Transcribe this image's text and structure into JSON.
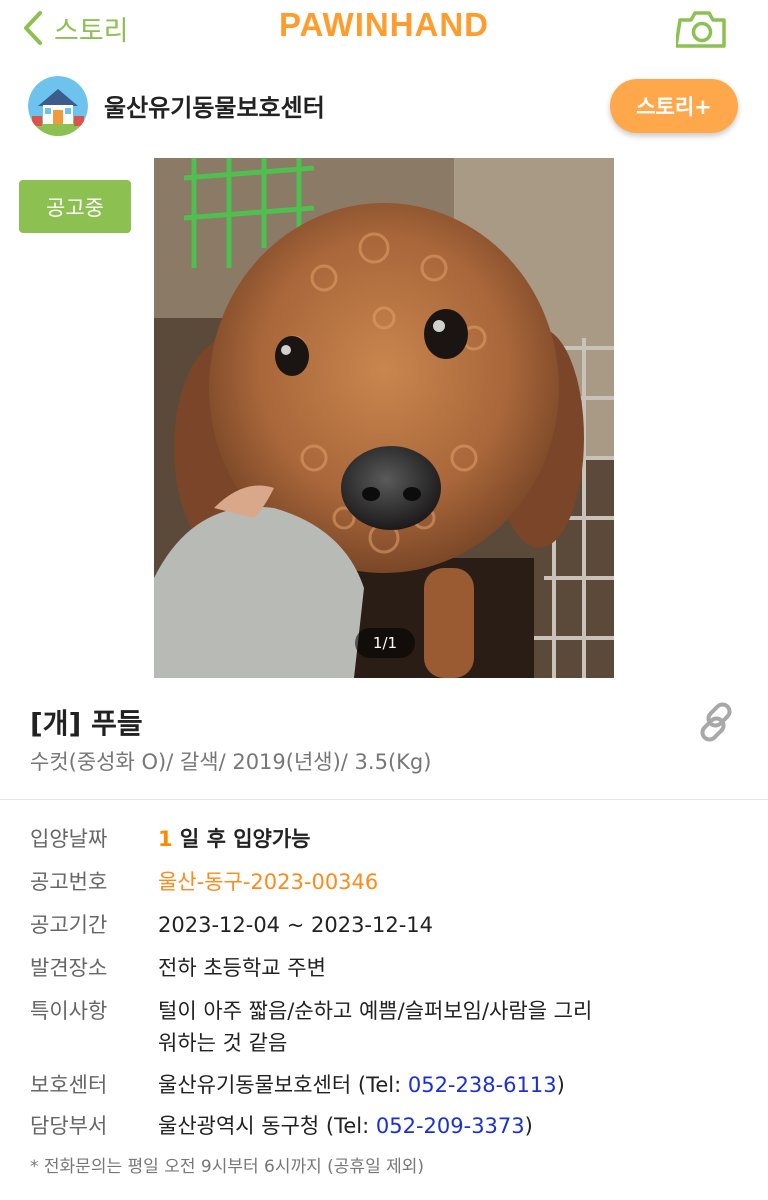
{
  "header": {
    "back_label": "스토리",
    "brand": "PAWINHAND",
    "camera_icon": "camera-icon"
  },
  "shelter": {
    "name": "울산유기동물보호센터",
    "story_button": "스토리+"
  },
  "status_badge": "공고중",
  "photo": {
    "counter": "1/1"
  },
  "animal": {
    "title": "[개] 푸들",
    "summary": "수컷(중성화 O)/ 갈색/ 2019(년생)/ 3.5(Kg)"
  },
  "info": {
    "adoption_date": {
      "label": "입양날짜",
      "days": "1",
      "suffix": " 일 후 입양가능"
    },
    "notice_no": {
      "label": "공고번호",
      "value": "울산-동구-2023-00346"
    },
    "notice_period": {
      "label": "공고기간",
      "value": "2023-12-04 ~ 2023-12-14"
    },
    "found_place": {
      "label": "발견장소",
      "value": "전하 초등학교 주변"
    },
    "remarks": {
      "label": "특이사항",
      "line1": "털이 아주 짧음/순하고 예쁨/슬퍼보임/사람을 그리",
      "line2": "워하는 것 같음"
    },
    "shelter_center": {
      "label": "보호센터",
      "name": "울산유기동물보호센터 (Tel: ",
      "tel": "052-238-6113",
      "close": ")"
    },
    "department": {
      "label": "담당부서",
      "name": "울산광역시 동구청 (Tel: ",
      "tel": "052-209-3373",
      "close": ")"
    }
  },
  "footnote": "* 전화문의는 평일 오전 9시부터 6시까지 (공휴일 제외)",
  "colors": {
    "green": "#8cc152",
    "orange": "#ff9c2e",
    "tel_blue": "#1a2fd6"
  }
}
